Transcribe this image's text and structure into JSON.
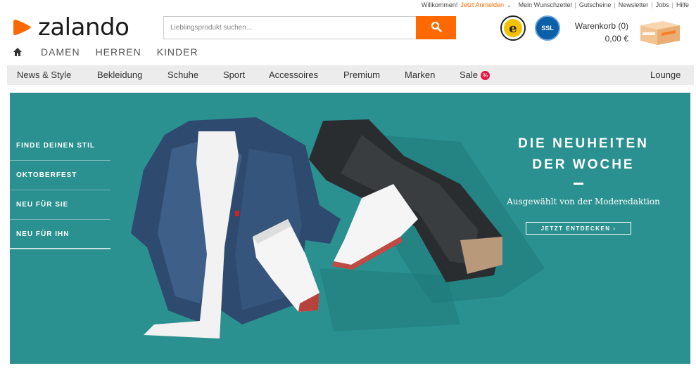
{
  "topbar": {
    "welcome": "Willkommen!",
    "login": "Jetzt Anmelden",
    "wishlist": "Mein Wunschzettel",
    "vouchers": "Gutscheine",
    "newsletter": "Newsletter",
    "jobs": "Jobs",
    "help": "Hilfe"
  },
  "logo": {
    "text": "zalando",
    "color": "#ff6900"
  },
  "gender_nav": {
    "home_icon": "home-icon",
    "items": [
      "DAMEN",
      "HERREN",
      "KINDER"
    ]
  },
  "search": {
    "placeholder": "Lieblingsprodukt suchen...",
    "icon": "search-icon",
    "button_color": "#ff6900"
  },
  "badges": {
    "trusted": "e",
    "ssl": "SSL"
  },
  "cart": {
    "label": "Warenkorb (0)",
    "total": "0,00 €"
  },
  "mainnav": {
    "items": [
      "News & Style",
      "Bekleidung",
      "Schuhe",
      "Sport",
      "Accessoires",
      "Premium",
      "Marken",
      "Sale"
    ],
    "sale_badge": "%",
    "lounge": "Lounge"
  },
  "hero": {
    "bg_color": "#2a9090",
    "side_menu": [
      "FINDE DEINEN STIL",
      "OKTOBERFEST",
      "NEU FÜR SIE",
      "NEU FÜR IHN"
    ],
    "title_line1": "DIE NEUHEITEN",
    "title_line2": "DER WOCHE",
    "subtitle": "Ausgewählt von der Moderedaktion",
    "cta": "JETZT ENTDECKEN ›"
  }
}
